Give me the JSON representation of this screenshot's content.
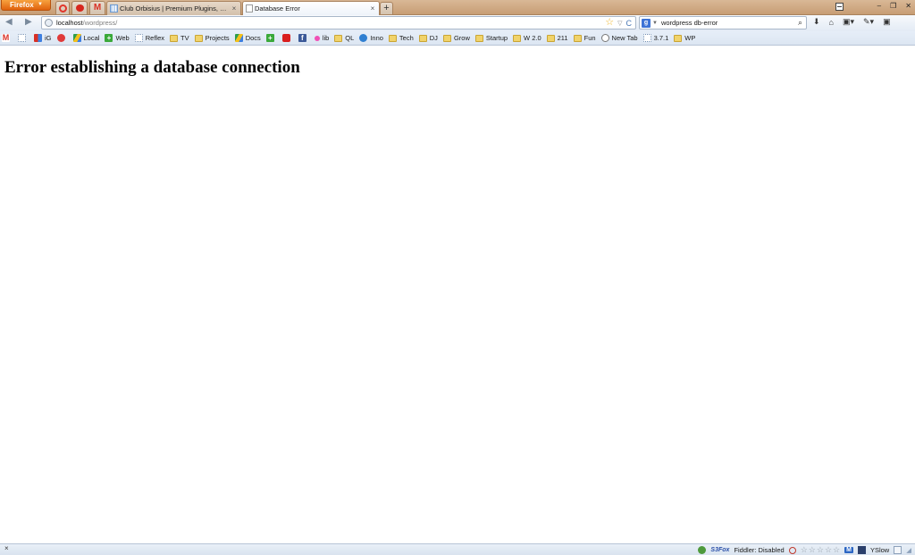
{
  "browser": {
    "menu_button": "Firefox",
    "menu_arrow": "▼",
    "app_tabs": [
      {
        "icon": "opera-like-red-circle-icon"
      },
      {
        "icon": "tomato-icon"
      },
      {
        "icon": "gmail-icon"
      }
    ],
    "tabs": [
      {
        "title": "Club Orbisius | Premium Plugins, Onl...",
        "close": "×",
        "active": false
      },
      {
        "title": "Database Error",
        "close": "×",
        "active": true
      }
    ],
    "new_tab": "+",
    "window_controls": {
      "minimize": "–",
      "restore": "❐",
      "close": "✕"
    }
  },
  "navigation": {
    "back": "◀",
    "forward": "▶",
    "url_host": "localhost",
    "url_path": "/wordpress/",
    "bookmark_star": "☆",
    "history_drop": "▽",
    "reload": "C",
    "search_engine_letter": "g",
    "search_value": "wordpress db-error",
    "search_go": "⌕",
    "toolbar_icons": [
      "⬇",
      "⌂",
      "▣▾",
      "✎▾",
      "▣"
    ]
  },
  "bookmarks": [
    {
      "label": "",
      "icon": "gmail"
    },
    {
      "label": "",
      "icon": "page"
    },
    {
      "label": "iG",
      "icon": "multi"
    },
    {
      "label": "",
      "icon": "red"
    },
    {
      "label": "Local",
      "icon": "drive"
    },
    {
      "label": "Web",
      "icon": "green"
    },
    {
      "label": "Reflex",
      "icon": "page"
    },
    {
      "label": "TV",
      "icon": "folder"
    },
    {
      "label": "Projects",
      "icon": "folder"
    },
    {
      "label": "Docs",
      "icon": "drive"
    },
    {
      "label": "",
      "icon": "green"
    },
    {
      "label": "",
      "icon": "yt"
    },
    {
      "label": "",
      "icon": "fb"
    },
    {
      "label": "lib",
      "icon": "pink"
    },
    {
      "label": "QL",
      "icon": "folder"
    },
    {
      "label": "Inno",
      "icon": "blue"
    },
    {
      "label": "Tech",
      "icon": "folder"
    },
    {
      "label": "DJ",
      "icon": "folder"
    },
    {
      "label": "Grow",
      "icon": "folder"
    },
    {
      "label": "Startup",
      "icon": "folder"
    },
    {
      "label": "W 2.0",
      "icon": "folder"
    },
    {
      "label": "211",
      "icon": "folder"
    },
    {
      "label": "Fun",
      "icon": "folder"
    },
    {
      "label": "New Tab",
      "icon": "wp"
    },
    {
      "label": "3.7.1",
      "icon": "page"
    },
    {
      "label": "WP",
      "icon": "folder"
    }
  ],
  "content": {
    "heading": "Error establishing a database connection"
  },
  "statusbar": {
    "close": "×",
    "s3fox": "S3Fox",
    "fiddler": "Fiddler: Disabled",
    "stars": [
      "☆",
      "☆",
      "☆",
      "☆",
      "☆"
    ],
    "w_badge": "M",
    "yslow": "YSlow"
  }
}
